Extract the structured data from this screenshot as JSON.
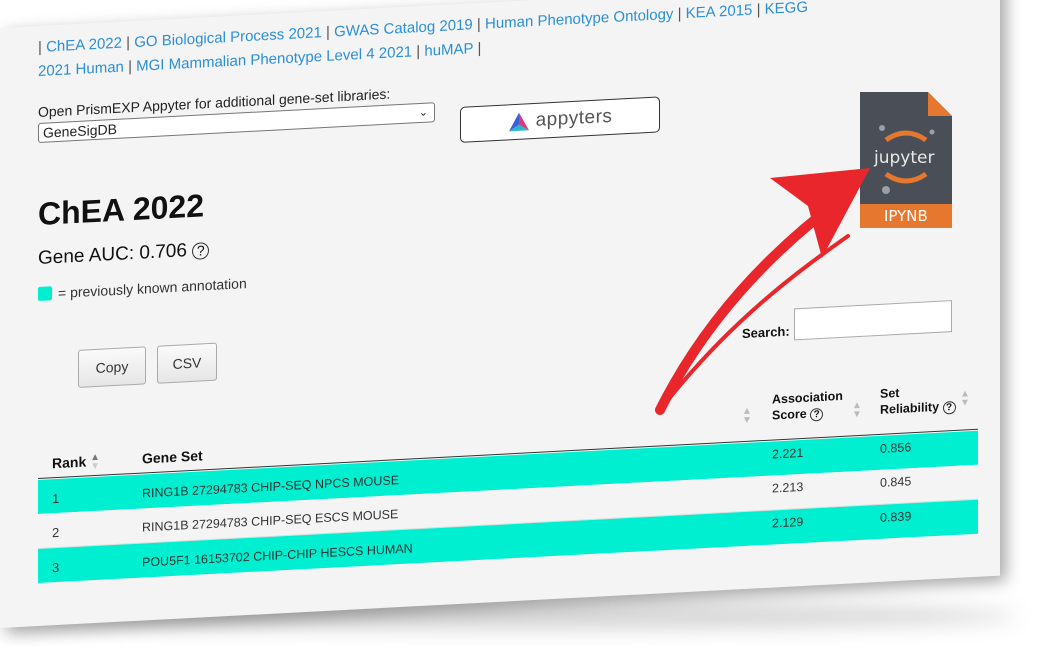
{
  "links": {
    "prefix": "| ",
    "items": [
      "ChEA 2022",
      "GO Biological Process 2021",
      "GWAS Catalog 2019",
      "Human Phenotype Ontology",
      "KEA 2015",
      "KEGG 2021 Human",
      "MGI Mammalian Phenotype Level 4 2021",
      "huMAP"
    ],
    "separator": " | "
  },
  "library_picker": {
    "label": "Open PrismEXP Appyter for additional gene-set libraries:",
    "selected": "GeneSigDB"
  },
  "appyters_button": {
    "label": "appyters"
  },
  "heading": {
    "title": "ChEA 2022",
    "auc_label": "Gene AUC: 0.706",
    "help": "?"
  },
  "legend": {
    "text": "= previously known annotation",
    "color": "#00efd0"
  },
  "toolbar": {
    "copy": "Copy",
    "csv": "CSV"
  },
  "search": {
    "label": "Search:",
    "value": ""
  },
  "table": {
    "headers": {
      "rank": "Rank",
      "gene_set": "Gene Set",
      "assoc_line1": "Association",
      "assoc_line2": "Score",
      "rel_line1": "Set",
      "rel_line2": "Reliability"
    },
    "rows": [
      {
        "rank": "1",
        "gene_set": "RING1B 27294783 CHIP-SEQ NPCS MOUSE",
        "score": "2.221",
        "reliability": "0.856",
        "known": true
      },
      {
        "rank": "2",
        "gene_set": "RING1B 27294783 CHIP-SEQ ESCS MOUSE",
        "score": "2.213",
        "reliability": "0.845",
        "known": false
      },
      {
        "rank": "3",
        "gene_set": "POU5F1 16153702 CHIP-CHIP HESCS HUMAN",
        "score": "2.129",
        "reliability": "0.839",
        "known": true
      }
    ]
  },
  "ipynb_icon": {
    "top_text": "jupyter",
    "bottom_text": "IPYNB"
  },
  "colors": {
    "link": "#2b8fd6",
    "known": "#00efd0",
    "arrow": "#e8262b",
    "ipynb_bar": "#e5772e"
  }
}
